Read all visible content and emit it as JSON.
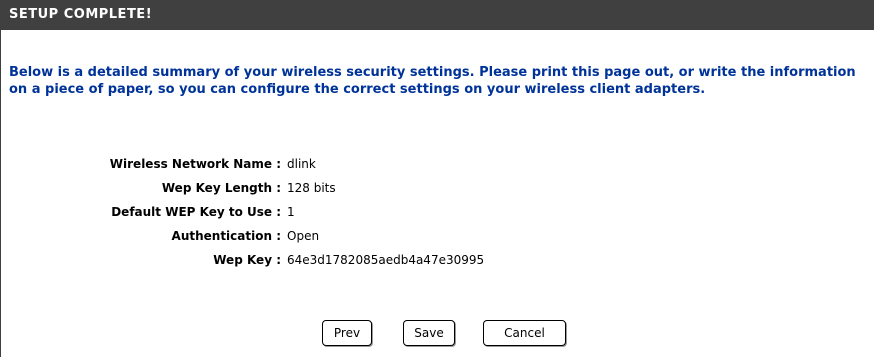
{
  "header": {
    "title": "SETUP COMPLETE!"
  },
  "summary": {
    "text": "Below is a detailed summary of your wireless security settings. Please print this page out, or write the information on a piece of paper, so you can configure the correct settings on your wireless client adapters."
  },
  "settings": [
    {
      "label": "Wireless Network Name :",
      "value": "dlink"
    },
    {
      "label": "Wep Key Length :",
      "value": "128 bits"
    },
    {
      "label": "Default WEP Key to Use :",
      "value": "1"
    },
    {
      "label": "Authentication :",
      "value": "Open"
    },
    {
      "label": "Wep Key :",
      "value": "64e3d1782085aedb4a47e30995"
    }
  ],
  "buttons": {
    "prev": "Prev",
    "save": "Save",
    "cancel": "Cancel"
  },
  "colors": {
    "header_bg": "#404040",
    "summary_text": "#003399"
  }
}
